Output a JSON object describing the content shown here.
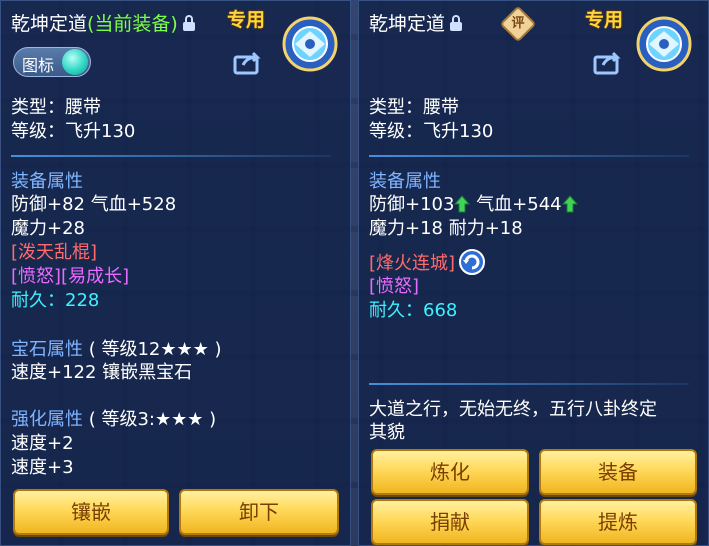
{
  "left": {
    "title": "乾坤定道",
    "title_status": "(当前装备)",
    "exclusive": "专用",
    "toggle_label": "图标",
    "type": "类型：腰带",
    "level": "等级：飞升130",
    "attr_header": "装备属性",
    "attr_line1": "防御+82 气血+528",
    "attr_line2": "魔力+28",
    "skill": "[泼天乱棍]",
    "specials": "[愤怒][易成长]",
    "durability_label": "耐久：",
    "durability_value": "228",
    "gem_header": "宝石属性",
    "gem_level": "( 等级12★★★ )",
    "gem_line": "速度+122 镶嵌黑宝石",
    "strengthen_header": "强化属性",
    "strengthen_level": "( 等级3:★★★ )",
    "strengthen_line1": "速度+2",
    "strengthen_line2": "速度+3",
    "btn_inlay": "镶嵌",
    "btn_unequip": "卸下"
  },
  "right": {
    "title": "乾坤定道",
    "eval_badge": "评",
    "exclusive": "专用",
    "type": "类型：腰带",
    "level": "等级：飞升130",
    "attr_header": "装备属性",
    "attr_def": "防御+103",
    "attr_hp": "气血+544",
    "attr_line2": "魔力+18 耐力+18",
    "skill": "[烽火连城]",
    "specials": "[愤怒]",
    "durability_label": "耐久：",
    "durability_value": "668",
    "description": "大道之行，无始无终，五行八卦终定",
    "description2": "其貌",
    "btn_refine": "炼化",
    "btn_equip": "装备",
    "btn_donate": "捐献",
    "btn_extract": "提炼"
  },
  "colors": {
    "section": "#7fb4ff",
    "skill": "#ff6b6b",
    "special": "#e86bff",
    "durability": "#3ff0ff",
    "button": "#ffd95a",
    "exclusive": "#ffd63a",
    "current": "#7dff47"
  }
}
